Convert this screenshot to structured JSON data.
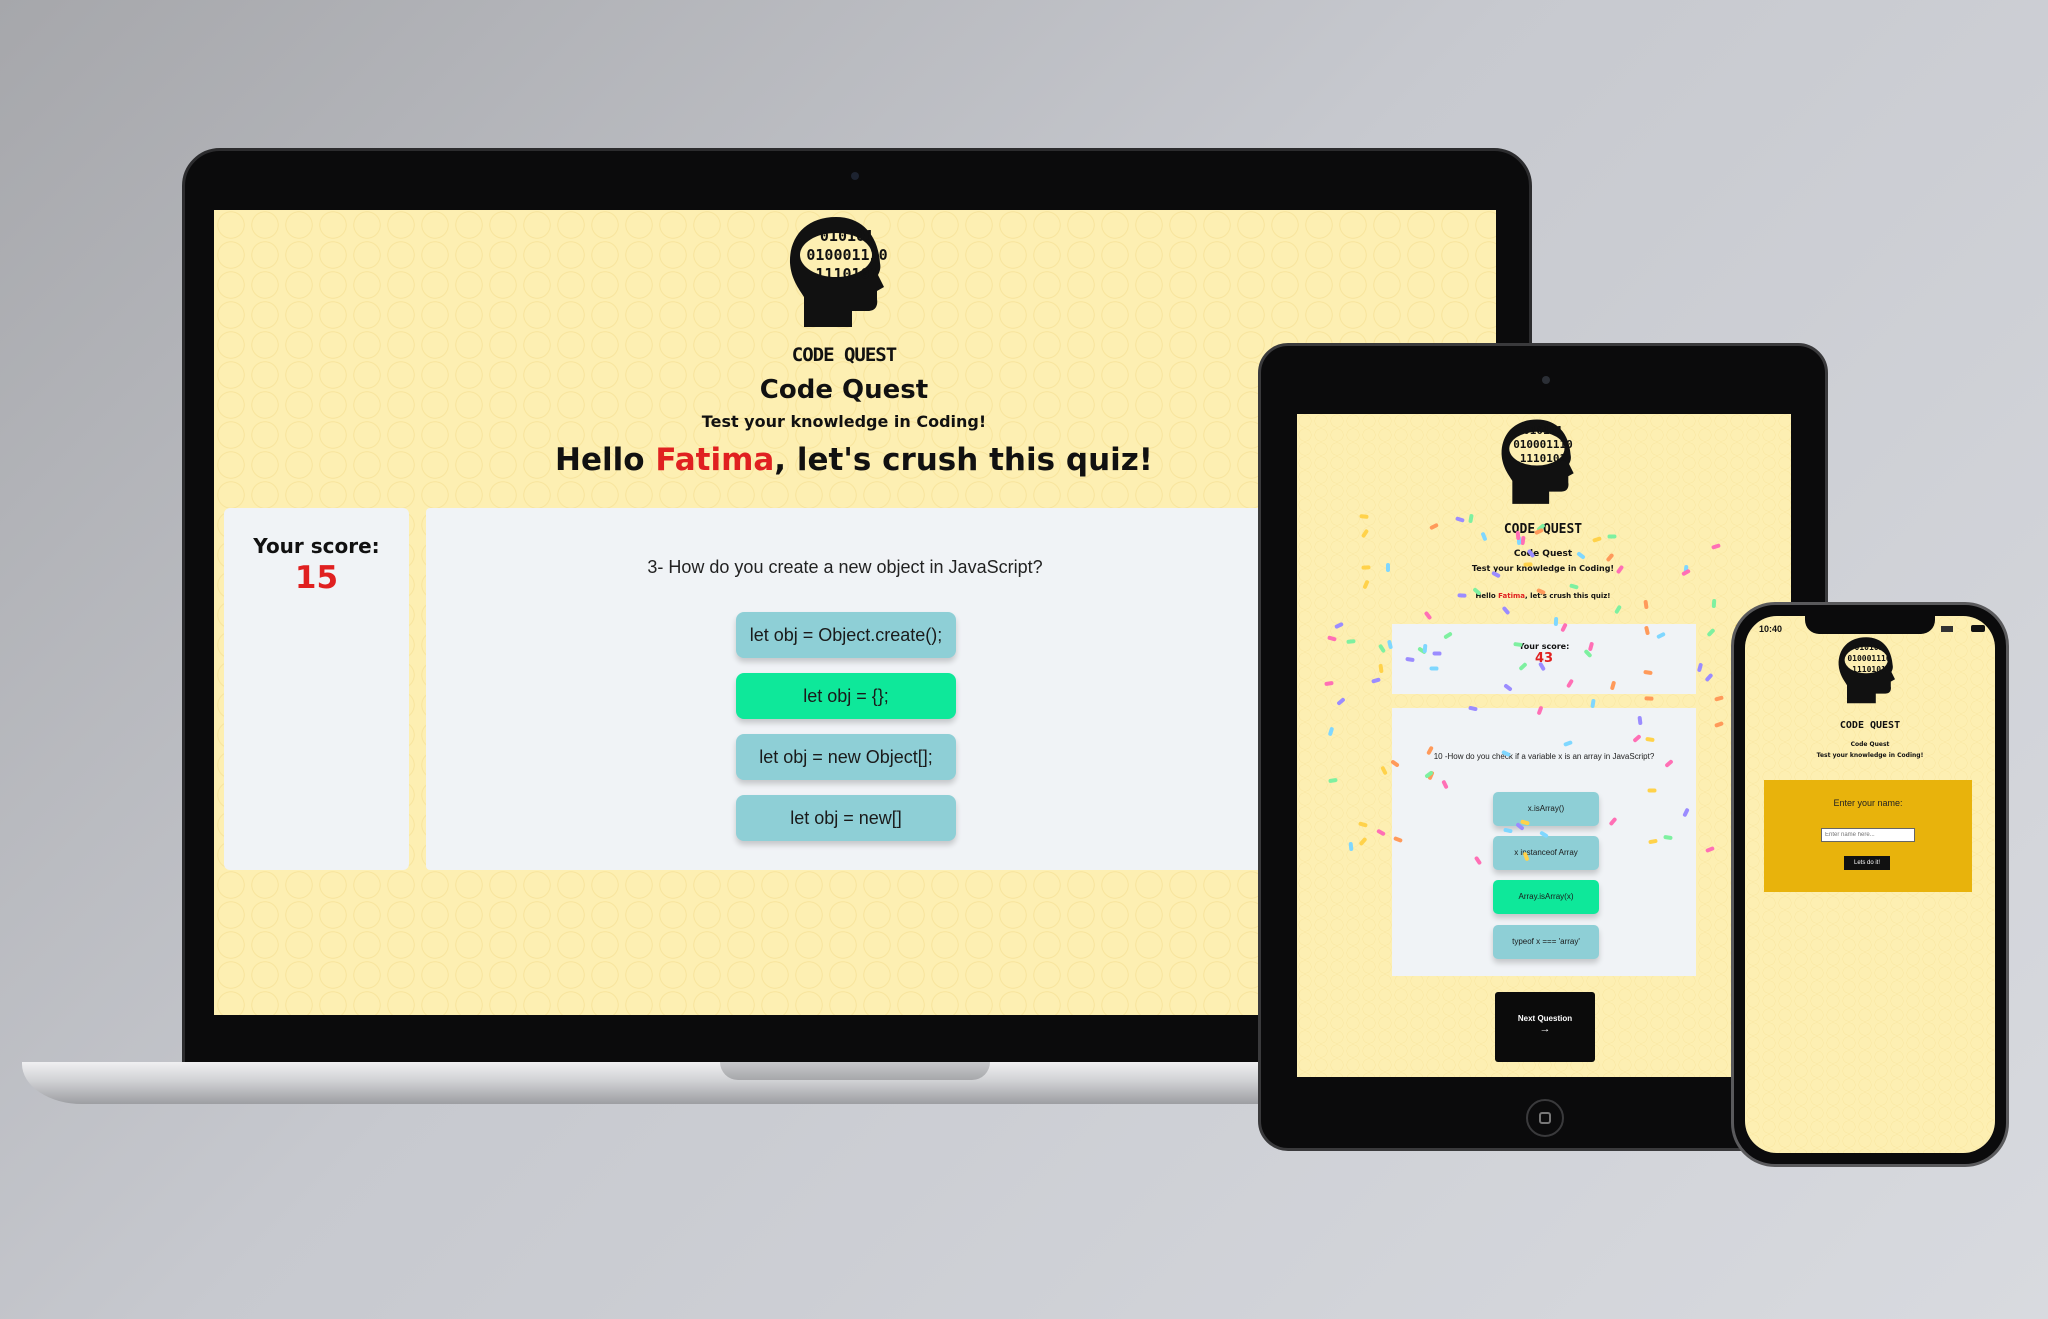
{
  "laptop": {
    "logo_label": "CODE QUEST",
    "logo_binary": [
      "010101",
      "010001110",
      "1110101"
    ],
    "title": "Code Quest",
    "subtitle": "Test your knowledge in Coding!",
    "greeting_prefix": "Hello ",
    "user_name": "Fatima",
    "greeting_suffix": ", let's crush this quiz!",
    "score_label": "Your score:",
    "score_value": "15",
    "question": "3- How do you create a new object in JavaScript?",
    "answers": [
      "let obj = Object.create();",
      "let obj = {};",
      "let obj = new Object[];",
      "let obj = new[]"
    ],
    "correct_index": 1
  },
  "tablet": {
    "logo_label": "CODE QUEST",
    "logo_binary": [
      "010101",
      "010001110",
      "1110101"
    ],
    "title": "Code Quest",
    "subtitle": "Test your knowledge in Coding!",
    "greeting_prefix": "Hello ",
    "user_name": "Fatima",
    "greeting_suffix": ", let's crush this quiz!",
    "score_label": "Your score:",
    "score_value": "43",
    "question": "10 -How do you check if a variable x is an array in JavaScript?",
    "answers": [
      "x.isArray()",
      "x instanceof Array",
      "Array.isArray(x)",
      "typeof x === 'array'"
    ],
    "correct_index": 2,
    "next_label": "Next Question",
    "next_arrow": "→"
  },
  "phone": {
    "time": "10:40",
    "logo_label": "CODE QUEST",
    "logo_binary": [
      "010101",
      "010001110",
      "1110101"
    ],
    "title": "Code Quest",
    "subtitle": "Test your knowledge in Coding!",
    "name_prompt": "Enter your name:",
    "name_placeholder": "Enter name here...",
    "submit_label": "Lets do it!"
  },
  "colors": {
    "page_bg": "#fdefb2",
    "accent_red": "#e02020",
    "correct_green": "#0ee89a",
    "answer_teal": "#8ecfd6",
    "name_box": "#e8b30c",
    "panel": "#f0f3f6"
  }
}
